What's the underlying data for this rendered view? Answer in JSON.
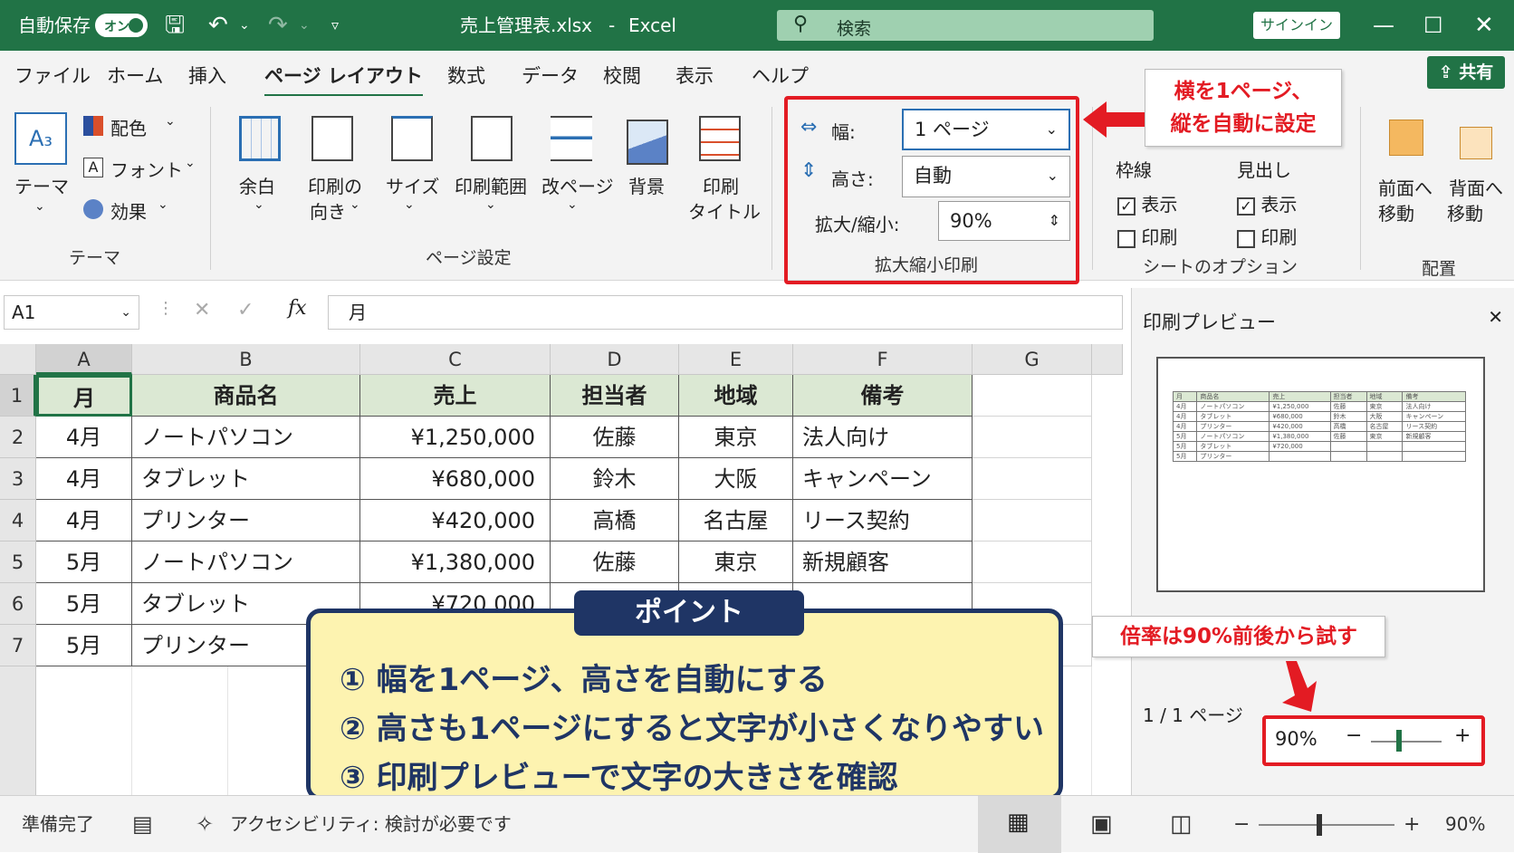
{
  "titlebar": {
    "autosave": "自動保存",
    "toggle": "オン",
    "filename": "売上管理表.xlsx",
    "separator": "-",
    "app": "Excel",
    "search_placeholder": "検索",
    "signin": "サインイン"
  },
  "menu": {
    "items": [
      "ファイル",
      "ホーム",
      "挿入",
      "ページ レイアウト",
      "数式",
      "データ",
      "校閲",
      "表示",
      "ヘルプ"
    ],
    "share": "共有"
  },
  "ribbon": {
    "themes": {
      "theme": "テーマ",
      "colors": "配色",
      "fonts": "フォント",
      "effects": "効果",
      "group": "テーマ"
    },
    "page_setup": {
      "margins": "余白",
      "orientation_1": "印刷の",
      "orientation_2": "向き",
      "size": "サイズ",
      "print_area": "印刷範囲",
      "breaks": "改ページ",
      "background": "背景",
      "print_titles_1": "印刷",
      "print_titles_2": "タイトル",
      "group": "ページ設定"
    },
    "scale": {
      "width_label": "幅:",
      "width_value": "1 ページ",
      "height_label": "高さ:",
      "height_value": "自動",
      "scale_label": "拡大/縮小:",
      "scale_value": "90%",
      "group": "拡大縮小印刷"
    },
    "sheet_options": {
      "gridlines": "枠線",
      "headings": "見出し",
      "view": "表示",
      "print": "印刷",
      "group": "シートのオプション"
    },
    "arrange": {
      "forward_1": "前面へ",
      "forward_2": "移動",
      "backward_1": "背面へ",
      "backward_2": "移動",
      "group": "配置"
    }
  },
  "formula": {
    "namebox": "A1",
    "content": "月"
  },
  "grid": {
    "columns": [
      "A",
      "B",
      "C",
      "D",
      "E",
      "F",
      "G"
    ],
    "rows": [
      "1",
      "2",
      "3",
      "4",
      "5",
      "6",
      "7"
    ],
    "header": [
      "月",
      "商品名",
      "売上",
      "担当者",
      "地域",
      "備考"
    ],
    "data": [
      [
        "4月",
        "ノートパソコン",
        "¥1,250,000",
        "佐藤",
        "東京",
        "法人向け"
      ],
      [
        "4月",
        "タブレット",
        "¥680,000",
        "鈴木",
        "大阪",
        "キャンペーン"
      ],
      [
        "4月",
        "プリンター",
        "¥420,000",
        "高橋",
        "名古屋",
        "リース契約"
      ],
      [
        "5月",
        "ノートパソコン",
        "¥1,380,000",
        "佐藤",
        "東京",
        "新規顧客"
      ],
      [
        "5月",
        "タブレット",
        "¥720,000",
        "",
        "",
        ""
      ],
      [
        "5月",
        "プリンター",
        "",
        "",
        "",
        ""
      ]
    ]
  },
  "preview": {
    "title": "印刷プレビュー",
    "page_info": "1 / 1 ページ",
    "zoom": "90%"
  },
  "callouts": {
    "top": [
      "横を1ページ、",
      "縦を自動に設定"
    ],
    "bottom": "倍率は90%前後から試す"
  },
  "point": {
    "title": "ポイント",
    "lines": [
      "① 幅を1ページ、高さを自動にする",
      "② 高さも1ページにすると文字が小さくなりやすい",
      "③ 印刷プレビューで文字の大きさを確認"
    ]
  },
  "status": {
    "ready": "準備完了",
    "accessibility": "アクセシビリティ: 検討が必要です",
    "zoom": "90%"
  },
  "colors": {
    "excel_green": "#217346",
    "red": "#e31b23",
    "navy": "#1f3565",
    "note_bg": "#fdf3b0",
    "header_fill": "#dbe8d3"
  }
}
